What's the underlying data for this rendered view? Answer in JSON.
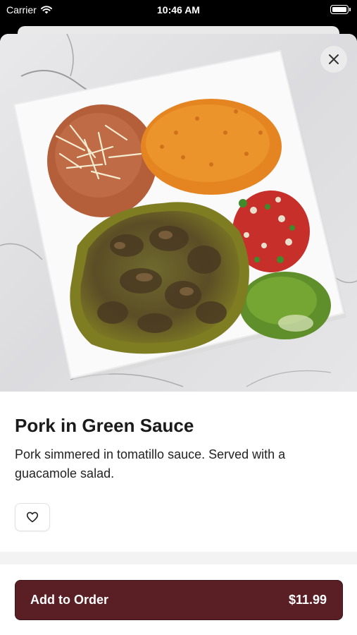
{
  "status_bar": {
    "carrier": "Carrier",
    "time": "10:46 AM"
  },
  "item": {
    "title": "Pork in Green Sauce",
    "description": "Pork simmered in tomatillo sauce. Served with a guacamole salad."
  },
  "actions": {
    "add_label": "Add to Order",
    "price": "$11.99"
  },
  "icons": {
    "close": "close-icon",
    "favorite": "heart-icon",
    "wifi": "wifi-icon",
    "battery": "battery-icon"
  },
  "colors": {
    "accent": "#5a1f25",
    "background": "#ffffff"
  }
}
